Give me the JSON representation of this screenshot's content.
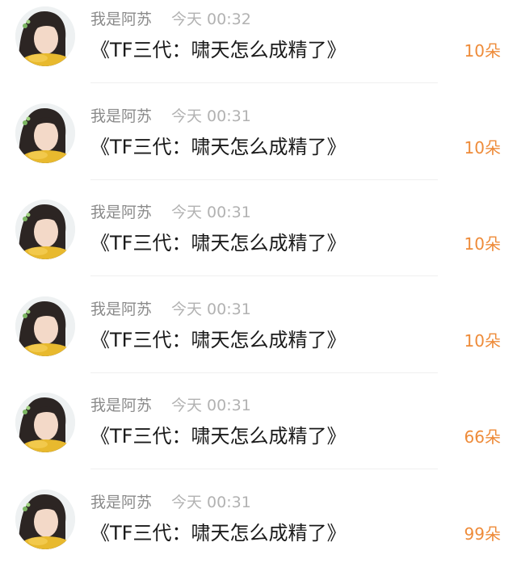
{
  "messages": [
    {
      "name": "我是阿苏",
      "time": "今天 00:32",
      "text": "《TF三代：啸天怎么成精了》",
      "gift": "10朵",
      "avatar_icon": "user-avatar"
    },
    {
      "name": "我是阿苏",
      "time": "今天 00:31",
      "text": "《TF三代：啸天怎么成精了》",
      "gift": "10朵",
      "avatar_icon": "user-avatar"
    },
    {
      "name": "我是阿苏",
      "time": "今天 00:31",
      "text": "《TF三代：啸天怎么成精了》",
      "gift": "10朵",
      "avatar_icon": "user-avatar"
    },
    {
      "name": "我是阿苏",
      "time": "今天 00:31",
      "text": "《TF三代：啸天怎么成精了》",
      "gift": "10朵",
      "avatar_icon": "user-avatar"
    },
    {
      "name": "我是阿苏",
      "time": "今天 00:31",
      "text": "《TF三代：啸天怎么成精了》",
      "gift": "66朵",
      "avatar_icon": "user-avatar"
    },
    {
      "name": "我是阿苏",
      "time": "今天 00:31",
      "text": "《TF三代：啸天怎么成精了》",
      "gift": "99朵",
      "avatar_icon": "user-avatar"
    }
  ],
  "colors": {
    "name": "#8b8b8b",
    "time": "#b2b2b2",
    "text": "#1a1a1a",
    "gift_accent": "#ee8b39",
    "divider": "#f0f0f0"
  }
}
